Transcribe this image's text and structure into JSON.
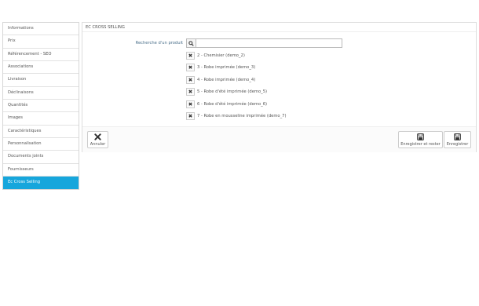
{
  "sidebar": {
    "items": [
      {
        "label": "Informations"
      },
      {
        "label": "Prix"
      },
      {
        "label": "Référencement - SEO"
      },
      {
        "label": "Associations"
      },
      {
        "label": "Livraison"
      },
      {
        "label": "Déclinaisons"
      },
      {
        "label": "Quantités"
      },
      {
        "label": "Images"
      },
      {
        "label": "Caractéristiques"
      },
      {
        "label": "Personnalisation"
      },
      {
        "label": "Documents joints"
      },
      {
        "label": "Fournisseurs"
      },
      {
        "label": "Ec Cross Selling"
      }
    ],
    "active_index": 12,
    "active_color": "#16a6dc"
  },
  "panel": {
    "title": "EC CROSS SELLING",
    "search_label": "Recherche d'un produit",
    "search_value": "",
    "search_icon": "search-icon",
    "products": [
      {
        "label": "2 - Chemisier (demo_2)"
      },
      {
        "label": "3 - Robe imprimée (demo_3)"
      },
      {
        "label": "4 - Robe imprimée (demo_4)"
      },
      {
        "label": "5 - Robe d'été imprimée (demo_5)"
      },
      {
        "label": "6 - Robe d'été imprimée (demo_6)"
      },
      {
        "label": "7 - Robe en mousseline imprimée (demo_7)"
      }
    ],
    "remove_icon": "close-icon"
  },
  "footer": {
    "cancel_label": "Annuler",
    "save_stay_label": "Enregistrer et rester",
    "save_label": "Enregistrer"
  }
}
